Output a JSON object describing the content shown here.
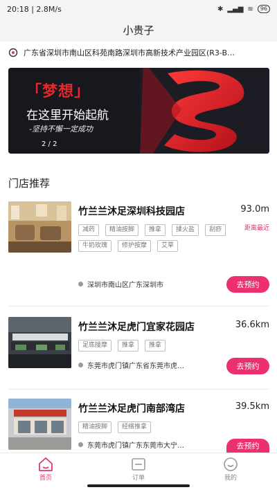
{
  "status_bar": {
    "time": "20:18 | 2.8M/s",
    "battery": "96"
  },
  "header": {
    "title": "小贵子"
  },
  "address": {
    "text": "广东省深圳市南山区科苑南路深圳市高新技术产业园区(R3-B…"
  },
  "banner": {
    "title": "「梦想」",
    "subtitle": "在这里开始起航",
    "tagline": "-坚持不懈一定成功",
    "page_indicator": "2 / 2"
  },
  "section": {
    "title": "门店推荐"
  },
  "stores": [
    {
      "name": "竹兰兰沐足深圳科技园店",
      "distance": "93.0m",
      "badge": "距离最近",
      "tags": [
        "减药",
        "精油按脚",
        "推拿",
        "揉火盐",
        "刮痧",
        "牛奶玫瑰",
        "修护按摩",
        "艾草"
      ],
      "location": "深圳市南山区广东深圳市",
      "book_label": "去预约"
    },
    {
      "name": "竹兰兰沐足虎门宜家花园店",
      "distance": "36.6km",
      "badge": "",
      "tags": [
        "足底接摩",
        "推拿",
        "推拿"
      ],
      "location": "东莞市虎门镇广东省东莞市虎…",
      "book_label": "去预约"
    },
    {
      "name": "竹兰兰沐足虎门南部湾店",
      "distance": "39.5km",
      "badge": "",
      "tags": [
        "精油按脚",
        "经络推拿"
      ],
      "location": "东莞市虎门镇广东东莞市大宁…",
      "book_label": "去预约"
    }
  ],
  "tabbar": {
    "home": "首页",
    "orders": "订单",
    "mine": "我的"
  },
  "colors": {
    "accent": "#ec2f6f",
    "banner_red": "#e6272e"
  },
  "icons": {
    "location": "location-pin-icon",
    "home": "home-icon",
    "orders": "orders-icon",
    "mine": "profile-icon"
  }
}
